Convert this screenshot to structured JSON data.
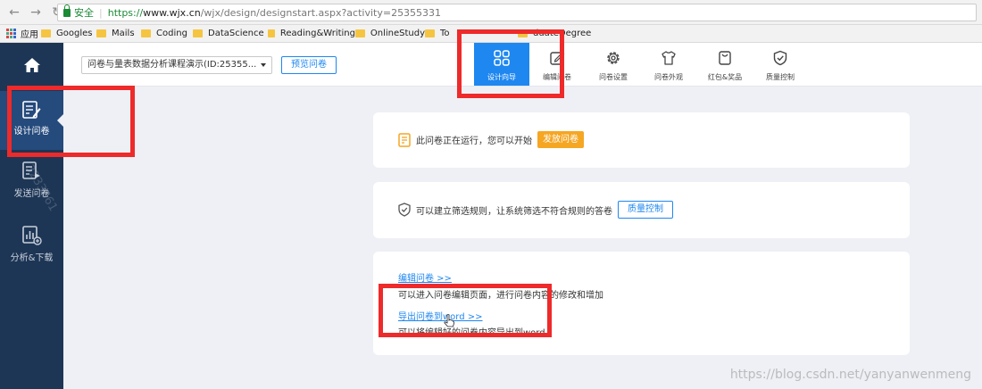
{
  "browser": {
    "secure_label": "安全",
    "url_scheme": "https://",
    "url_host": "www.wjx.cn",
    "url_path": "/wjx/design/designstart.aspx?activity=25355331",
    "bookmarks": [
      "应用",
      "Googles",
      "Mails",
      "Coding",
      "DataScience",
      "Reading&Writing",
      "OnlineStudy",
      "To",
      "duateDegree"
    ]
  },
  "sidebar": {
    "items": [
      {
        "label": "设计问卷",
        "icon": "design-survey-icon",
        "active": true
      },
      {
        "label": "发送问卷",
        "icon": "send-survey-icon",
        "active": false
      },
      {
        "label": "分析&下载",
        "icon": "analysis-download-icon",
        "active": false
      }
    ]
  },
  "topbar": {
    "survey_select": "问卷与量表数据分析课程演示(ID:25355...",
    "preview_button": "预览问卷",
    "tools": [
      {
        "label": "设计向导",
        "icon": "grid-icon",
        "active": true
      },
      {
        "label": "编辑问卷",
        "icon": "edit-icon",
        "active": false
      },
      {
        "label": "问卷设置",
        "icon": "gear-icon",
        "active": false
      },
      {
        "label": "问卷外观",
        "icon": "shirt-icon",
        "active": false
      },
      {
        "label": "红包&奖品",
        "icon": "gift-bag-icon",
        "active": false
      },
      {
        "label": "质量控制",
        "icon": "shield-check-icon",
        "active": false
      }
    ]
  },
  "cards": {
    "running": {
      "text": "此问卷正在运行，您可以开始",
      "button": "发放问卷"
    },
    "quality": {
      "text": "可以建立筛选规则，让系统筛选不符合规则的答卷",
      "button": "质量控制"
    },
    "actions": {
      "edit_link": "编辑问卷 >>",
      "edit_desc": "可以进入问卷编辑页面，进行问卷内容的修改和增加",
      "export_link": "导出问卷到word >>",
      "export_desc": "可以将编辑好的问卷内容导出到word"
    }
  },
  "overlay": {
    "watermark": "https://blog.csdn.net/yanyanwenmeng",
    "side_watermark": "3233661"
  },
  "colors": {
    "accent": "#1e87f0",
    "sidebar": "#1e3655",
    "sidebar_active": "#254a7c",
    "publish": "#f5a623",
    "highlight": "#ee2a2a"
  }
}
